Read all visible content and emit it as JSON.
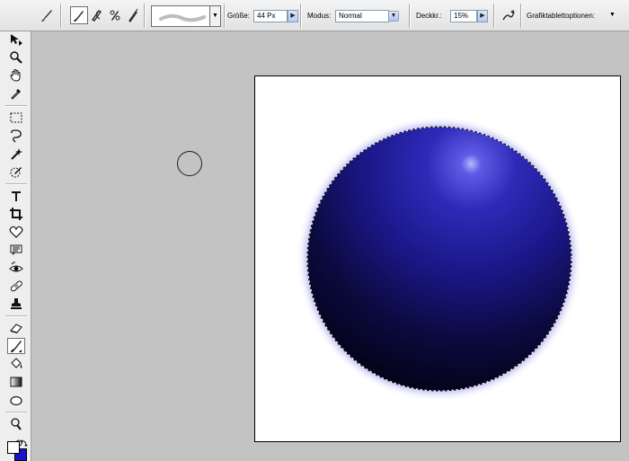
{
  "options_bar": {
    "size_label": "Größe:",
    "size_value": "44 Px",
    "mode_label": "Modus:",
    "mode_value": "Normal",
    "opacity_label": "Deckkr.:",
    "opacity_value": "15%",
    "tablet_label": "Grafiktablettoptionen:",
    "brush_preset_icon": "brush-tool-icon",
    "active_brush_mode": "brush"
  },
  "toolbox": {
    "tools": [
      {
        "name": "move-tool",
        "icon": "move-icon"
      },
      {
        "name": "zoom-tool",
        "icon": "magnifier-icon"
      },
      {
        "name": "hand-tool",
        "icon": "hand-icon"
      },
      {
        "name": "eyedropper-tool",
        "icon": "eyedropper-icon"
      },
      {
        "name": "marquee-tool",
        "icon": "marquee-icon"
      },
      {
        "name": "lasso-tool",
        "icon": "lasso-icon"
      },
      {
        "name": "magic-wand-tool",
        "icon": "magic-wand-icon"
      },
      {
        "name": "quick-selection-tool",
        "icon": "quick-select-icon"
      },
      {
        "name": "type-tool",
        "icon": "type-icon"
      },
      {
        "name": "crop-tool",
        "icon": "crop-icon"
      },
      {
        "name": "shape-tool",
        "icon": "custom-shape-icon"
      },
      {
        "name": "note-tool",
        "icon": "notes-icon"
      },
      {
        "name": "red-eye-tool",
        "icon": "red-eye-icon"
      },
      {
        "name": "healing-brush-tool",
        "icon": "bandage-icon"
      },
      {
        "name": "clone-stamp-tool",
        "icon": "stamp-icon"
      },
      {
        "name": "eraser-tool",
        "icon": "eraser-icon"
      },
      {
        "name": "brush-tool",
        "icon": "brush-icon",
        "active": true
      },
      {
        "name": "paint-bucket-tool",
        "icon": "bucket-icon"
      },
      {
        "name": "gradient-tool",
        "icon": "gradient-icon"
      },
      {
        "name": "ellipse-tool",
        "icon": "ellipse-icon"
      },
      {
        "name": "sponge-tool",
        "icon": "sponge-icon"
      },
      {
        "name": "smudge-tool",
        "icon": "smudge-icon"
      }
    ],
    "foreground_color": "#ffffff",
    "background_color": "#1a12c8"
  },
  "canvas": {
    "background": "#ffffff",
    "sphere_color": "#2a24b4",
    "selection": "ellipse-marquee"
  }
}
